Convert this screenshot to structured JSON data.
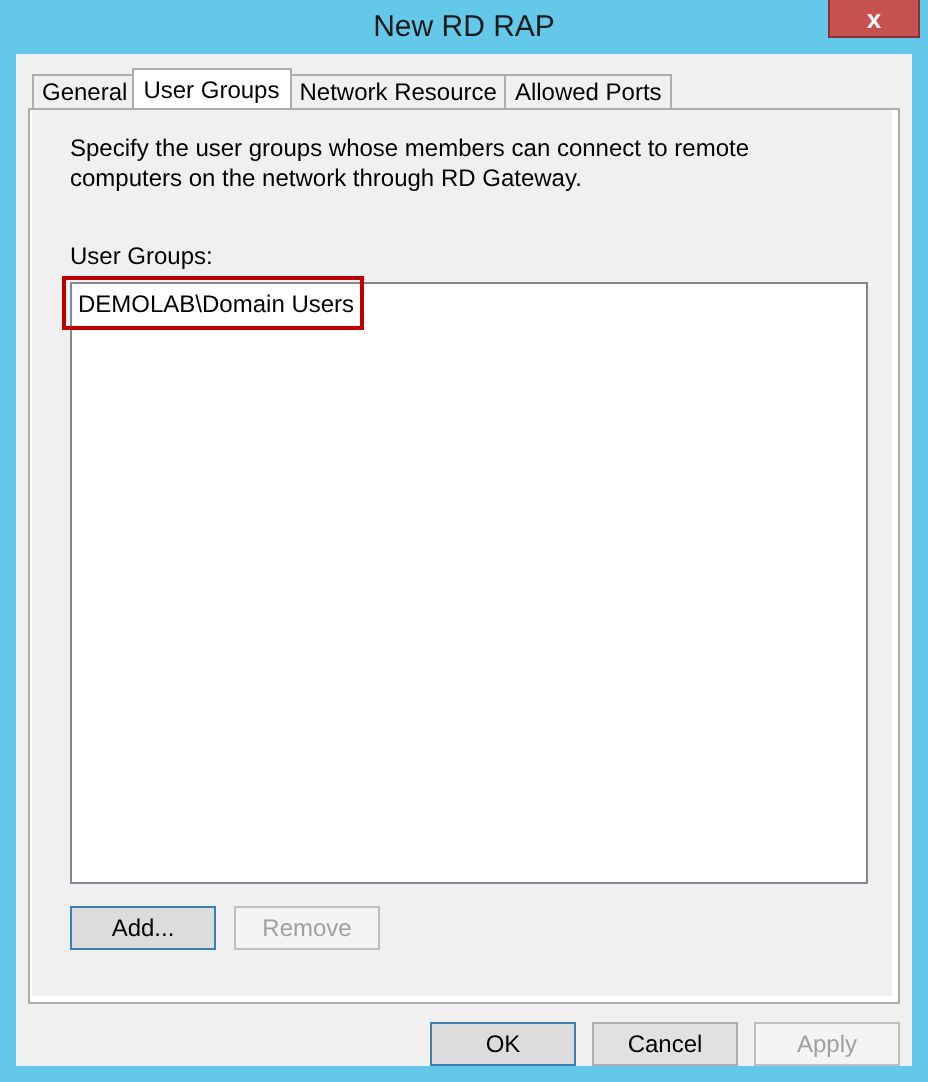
{
  "window": {
    "title": "New RD RAP",
    "close": "x"
  },
  "tabs": [
    {
      "label": "General",
      "selected": false
    },
    {
      "label": "User Groups",
      "selected": true
    },
    {
      "label": "Network Resource",
      "selected": false
    },
    {
      "label": "Allowed Ports",
      "selected": false
    }
  ],
  "description": "Specify the user groups whose members can connect to remote computers on the network through RD Gateway.",
  "list_label": "User Groups:",
  "user_groups": [
    {
      "name": "DEMOLAB\\Domain Users",
      "highlighted": true
    }
  ],
  "list_buttons": [
    {
      "label": "Add...",
      "disabled": false,
      "focused": true
    },
    {
      "label": "Remove",
      "disabled": true,
      "focused": false
    }
  ],
  "dialog_buttons": [
    {
      "label": "OK",
      "disabled": false,
      "focused": true
    },
    {
      "label": "Cancel",
      "disabled": false,
      "focused": false
    },
    {
      "label": "Apply",
      "disabled": true,
      "focused": false
    }
  ]
}
